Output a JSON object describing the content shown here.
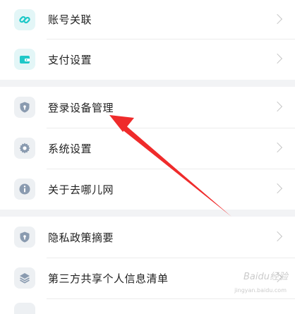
{
  "groups": [
    {
      "items": [
        {
          "label": "账号关联",
          "icon": "link-icon"
        },
        {
          "label": "支付设置",
          "icon": "wallet-icon"
        }
      ]
    },
    {
      "items": [
        {
          "label": "登录设备管理",
          "icon": "shield-icon"
        },
        {
          "label": "系统设置",
          "icon": "gear-icon"
        },
        {
          "label": "关于去哪儿网",
          "icon": "info-icon"
        }
      ]
    },
    {
      "items": [
        {
          "label": "隐私政策摘要",
          "icon": "shield-icon"
        },
        {
          "label": "第三方共享个人信息清单",
          "icon": "layers-icon"
        }
      ]
    }
  ],
  "watermark": {
    "text": "Baidu经验",
    "sub": "jingyan.baidu.com"
  },
  "colors": {
    "accent_teal": "#1ec8c8",
    "icon_gray": "#8a9bb0",
    "annotation_arrow": "#ef2b2b"
  }
}
